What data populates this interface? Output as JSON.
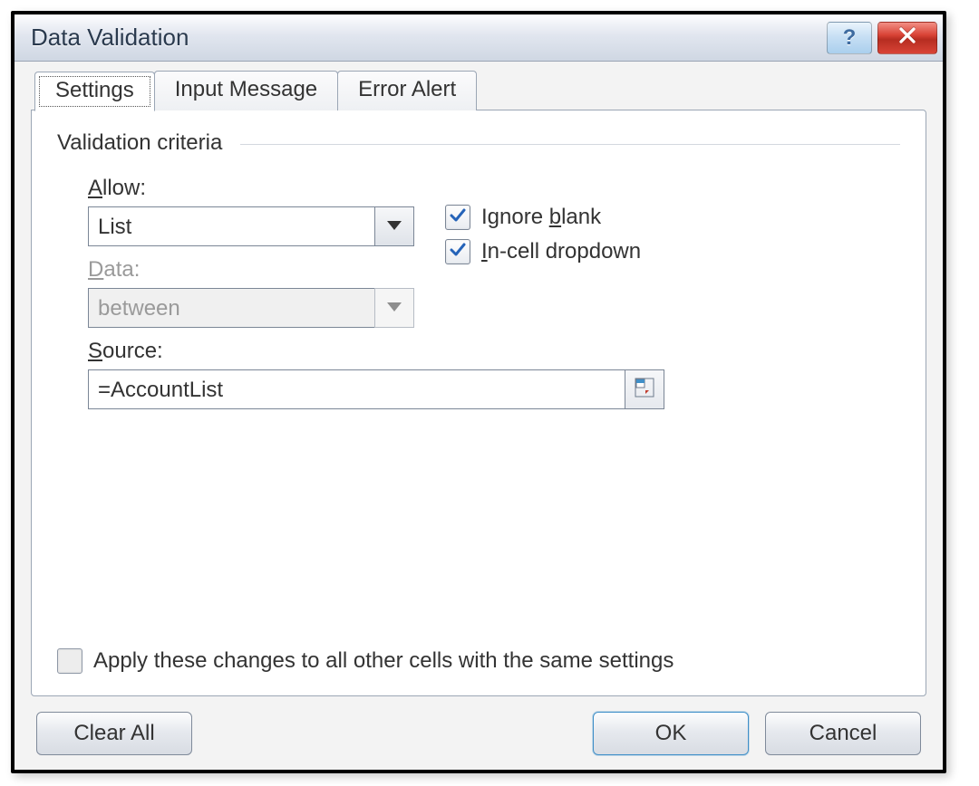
{
  "dialog": {
    "title": "Data Validation",
    "help_glyph": "?"
  },
  "tabs": {
    "settings": "Settings",
    "input_message": "Input Message",
    "error_alert": "Error Alert"
  },
  "criteria": {
    "legend": "Validation criteria",
    "allow_label": "Allow:",
    "allow_value": "List",
    "data_label": "Data:",
    "data_value": "between",
    "source_label": "Source:",
    "source_value": "=AccountList"
  },
  "checkboxes": {
    "ignore_blank_pre": "Ignore ",
    "ignore_blank_u": "b",
    "ignore_blank_post": "lank",
    "ignore_blank_checked": true,
    "incell_pre": "",
    "incell_u": "I",
    "incell_post": "n-cell dropdown",
    "incell_checked": true,
    "apply_label": "Apply these changes to all other cells with the same settings",
    "apply_checked": false
  },
  "buttons": {
    "clear_all": "Clear All",
    "ok": "OK",
    "cancel": "Cancel"
  }
}
